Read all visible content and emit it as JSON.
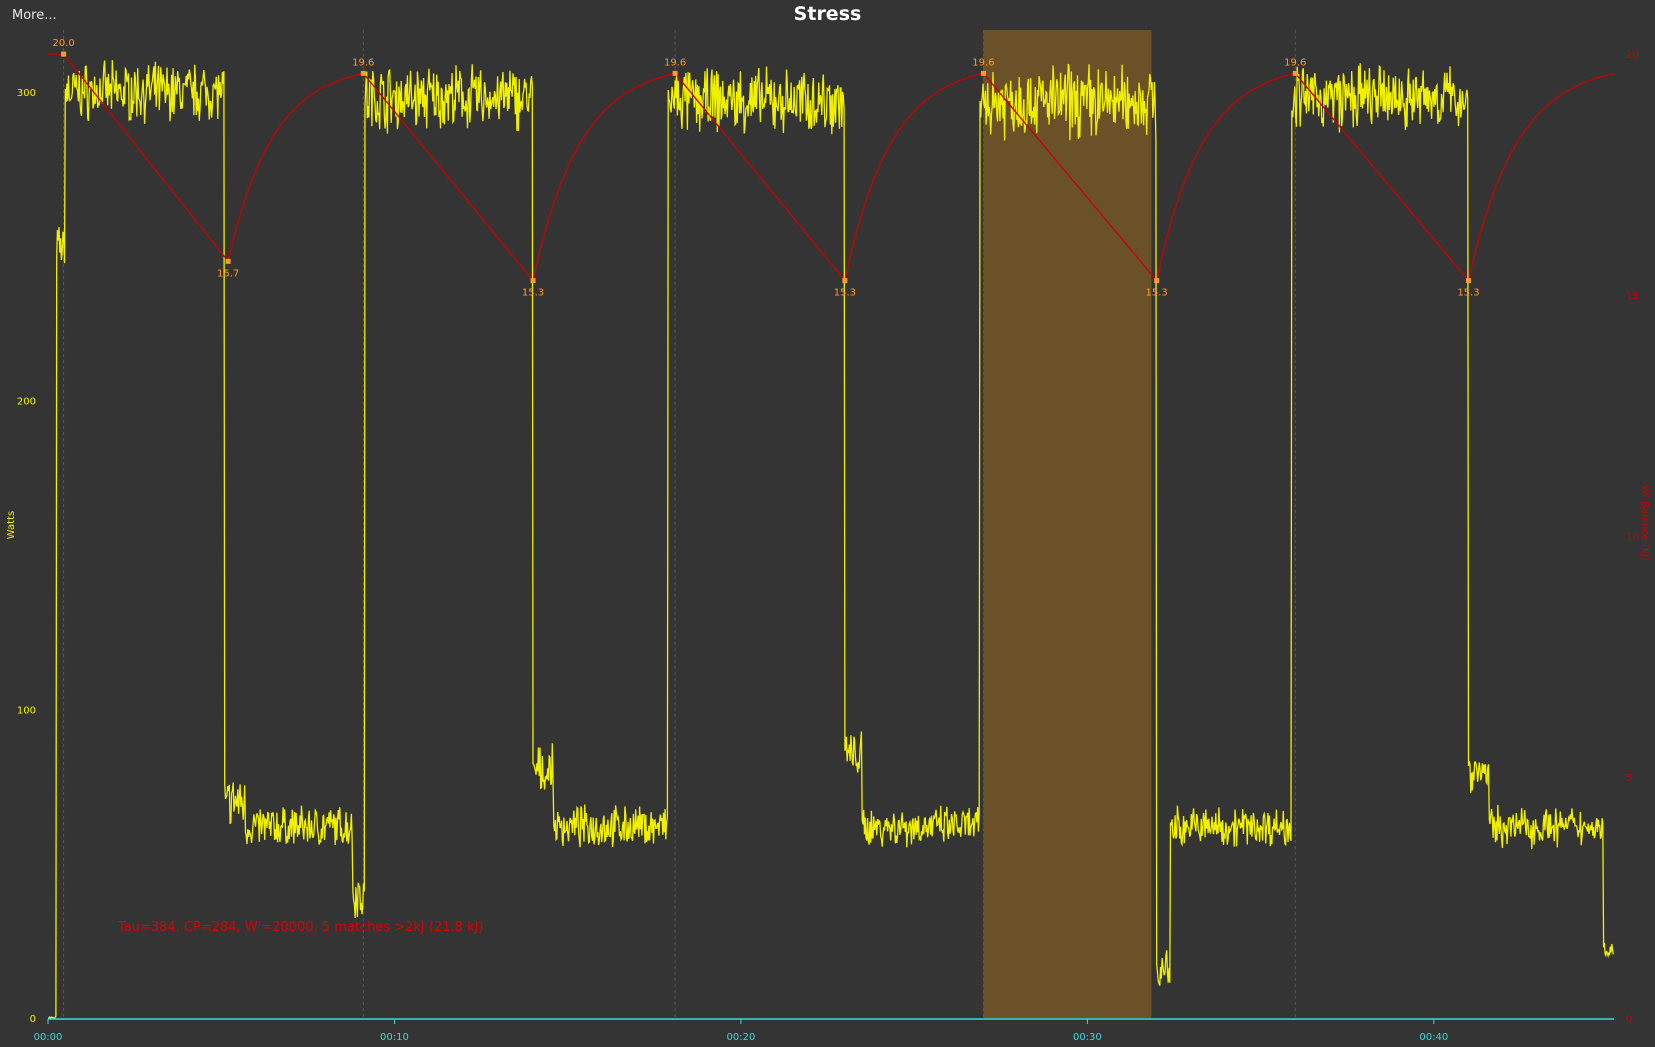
{
  "header": {
    "more_label": "More..."
  },
  "chart_data": {
    "type": "line",
    "title": "Stress",
    "xlabel": "",
    "ylabel": "Watts",
    "ylabel_right": "W' Balance (kJ)",
    "x_unit": "minutes",
    "xlim": [
      0,
      45.2
    ],
    "ylim": [
      0,
      320
    ],
    "ylim_right": [
      0,
      20.5
    ],
    "x_ticks": [
      "00:00",
      "00:10",
      "00:20",
      "00:30",
      "00:40"
    ],
    "y_ticks": [
      "0",
      "100",
      "200",
      "300"
    ],
    "y_ticks_right": [
      "0",
      "5",
      "10",
      "15",
      "20"
    ],
    "grid": "vertical dashed lines at W' balance peaks",
    "colors": {
      "power": "#f0f000",
      "wbal": "#cc0000",
      "match": "#ff9a2e",
      "highlight": "#c8901e",
      "axis": "#3fd8d8"
    },
    "series": [
      {
        "name": "Watts",
        "axis": "left",
        "segments": [
          {
            "x0": 0.0,
            "x1": 0.25,
            "level": 0,
            "noise": 0.5
          },
          {
            "x0": 0.25,
            "x1": 0.5,
            "level": 250,
            "noise": 5
          },
          {
            "x0": 0.5,
            "x1": 5.1,
            "level": 300,
            "noise": 7
          },
          {
            "x0": 5.1,
            "x1": 5.7,
            "level": 70,
            "noise": 6
          },
          {
            "x0": 5.7,
            "x1": 8.8,
            "level": 62,
            "noise": 5
          },
          {
            "x0": 8.8,
            "x1": 9.15,
            "level": 40,
            "noise": 6
          },
          {
            "x0": 9.15,
            "x1": 14.0,
            "level": 298,
            "noise": 8
          },
          {
            "x0": 14.0,
            "x1": 14.6,
            "level": 80,
            "noise": 6
          },
          {
            "x0": 14.6,
            "x1": 17.9,
            "level": 62,
            "noise": 5
          },
          {
            "x0": 17.9,
            "x1": 23.0,
            "level": 297,
            "noise": 8
          },
          {
            "x0": 23.0,
            "x1": 23.5,
            "level": 85,
            "noise": 6
          },
          {
            "x0": 23.5,
            "x1": 26.9,
            "level": 62,
            "noise": 5
          },
          {
            "x0": 26.9,
            "x1": 32.0,
            "level": 297,
            "noise": 9
          },
          {
            "x0": 32.0,
            "x1": 32.4,
            "level": 15,
            "noise": 5
          },
          {
            "x0": 32.4,
            "x1": 35.9,
            "level": 62,
            "noise": 5
          },
          {
            "x0": 35.9,
            "x1": 41.0,
            "level": 298,
            "noise": 8
          },
          {
            "x0": 41.0,
            "x1": 41.6,
            "level": 80,
            "noise": 6
          },
          {
            "x0": 41.6,
            "x1": 44.9,
            "level": 62,
            "noise": 5
          },
          {
            "x0": 44.9,
            "x1": 45.2,
            "level": 22,
            "noise": 2
          }
        ]
      },
      {
        "name": "W' Balance (kJ)",
        "axis": "right",
        "points": [
          [
            0.0,
            20.0
          ],
          [
            0.45,
            20.0
          ],
          [
            5.2,
            15.7
          ],
          [
            9.1,
            19.6
          ],
          [
            14.0,
            15.3
          ],
          [
            18.1,
            19.6
          ],
          [
            23.0,
            15.3
          ],
          [
            27.0,
            19.6
          ],
          [
            32.0,
            15.3
          ],
          [
            36.0,
            19.6
          ],
          [
            41.0,
            15.3
          ],
          [
            45.2,
            19.6
          ]
        ]
      }
    ],
    "w_bal_labels": [
      {
        "x": 0.45,
        "y": 20.0,
        "text": "20.0",
        "pos": "above"
      },
      {
        "x": 5.2,
        "y": 15.7,
        "text": "15.7",
        "pos": "below"
      },
      {
        "x": 9.1,
        "y": 19.6,
        "text": "19.6",
        "pos": "above"
      },
      {
        "x": 14.0,
        "y": 15.3,
        "text": "15.3",
        "pos": "below"
      },
      {
        "x": 18.1,
        "y": 19.6,
        "text": "19.6",
        "pos": "above"
      },
      {
        "x": 23.0,
        "y": 15.3,
        "text": "15.3",
        "pos": "below"
      },
      {
        "x": 27.0,
        "y": 19.6,
        "text": "19.6",
        "pos": "above"
      },
      {
        "x": 32.0,
        "y": 15.3,
        "text": "15.3",
        "pos": "below"
      },
      {
        "x": 36.0,
        "y": 19.6,
        "text": "19.6",
        "pos": "above"
      },
      {
        "x": 41.0,
        "y": 15.3,
        "text": "15.3",
        "pos": "below"
      }
    ],
    "vlines_x": [
      0.45,
      9.1,
      18.1,
      27.0,
      36.0
    ],
    "highlight_range": [
      27.0,
      31.85
    ],
    "annotation": "Tau=384, CP=284, W'=20000, 5 matches >2kJ (21.8 kJ)"
  }
}
